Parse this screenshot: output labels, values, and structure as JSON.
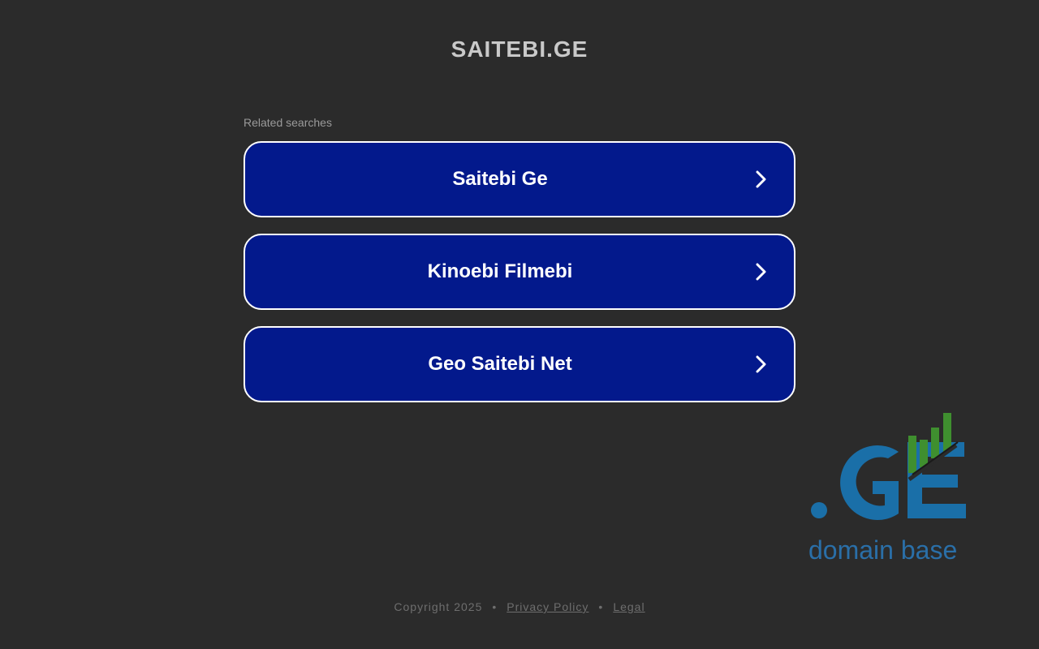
{
  "header": {
    "title": "SAITEBI.GE"
  },
  "related": {
    "label": "Related searches",
    "items": [
      {
        "label": "Saitebi Ge"
      },
      {
        "label": "Kinoebi Filmebi"
      },
      {
        "label": "Geo Saitebi Net"
      }
    ]
  },
  "logo": {
    "mark": ".GE",
    "tagline": "domain base",
    "colors": {
      "blue": "#1a6fa8",
      "green": "#3f8f2f"
    }
  },
  "footer": {
    "copyright": "Copyright 2025",
    "separator": "•",
    "privacy": "Privacy Policy",
    "legal": "Legal"
  },
  "colors": {
    "background": "#2b2b2b",
    "button": "#03198c",
    "button_border": "#ffffff"
  }
}
